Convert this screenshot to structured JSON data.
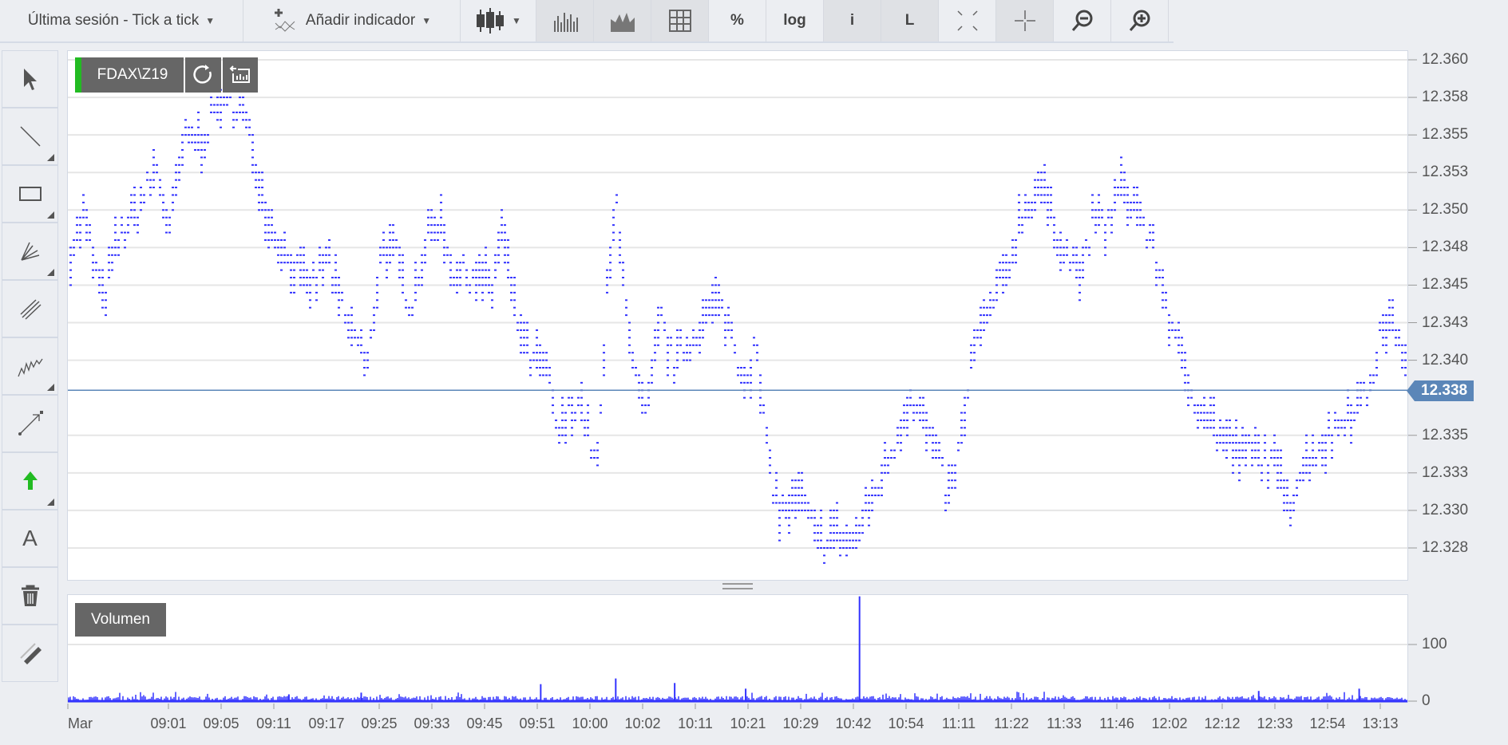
{
  "toolbar": {
    "period_label": "Última sesión - Tick a tick",
    "indicator_label": "Añadir indicador",
    "percent_label": "%",
    "log_label": "log",
    "info_label": "i",
    "L_label": "L"
  },
  "side_tools": [
    "cursor",
    "line",
    "rectangle",
    "fan",
    "parallel-lines",
    "freehand",
    "arrow-line",
    "green-arrow",
    "text",
    "trash",
    "eraser"
  ],
  "side_text_label": "A",
  "colors": {
    "ticks": "#3333ff",
    "current": "#5b86b8",
    "accent_green": "#22bb22"
  },
  "chart_data": {
    "type": "scatter",
    "symbol": "FDAX\\Z19",
    "volume_label": "Volumen",
    "current_price_label": "12.338",
    "current_price": 12338,
    "ylim": [
      12326,
      12361
    ],
    "y_ticks": [
      {
        "v": 12360,
        "label": "12.360"
      },
      {
        "v": 12357.5,
        "label": "12.358"
      },
      {
        "v": 12355,
        "label": "12.355"
      },
      {
        "v": 12352.5,
        "label": "12.353"
      },
      {
        "v": 12350,
        "label": "12.350"
      },
      {
        "v": 12347.5,
        "label": "12.348"
      },
      {
        "v": 12345,
        "label": "12.345"
      },
      {
        "v": 12342.5,
        "label": "12.343"
      },
      {
        "v": 12340,
        "label": "12.340"
      },
      {
        "v": 12335,
        "label": "12.335"
      },
      {
        "v": 12332.5,
        "label": "12.333"
      },
      {
        "v": 12330,
        "label": "12.330"
      },
      {
        "v": 12327.5,
        "label": "12.328"
      }
    ],
    "x_labels": [
      "Mar",
      "09:01",
      "09:05",
      "09:11",
      "09:17",
      "09:25",
      "09:33",
      "09:45",
      "09:51",
      "10:00",
      "10:02",
      "10:11",
      "10:21",
      "10:29",
      "10:42",
      "10:54",
      "11:11",
      "11:22",
      "11:33",
      "11:46",
      "12:02",
      "12:12",
      "12:33",
      "12:54",
      "13:13"
    ],
    "tick_range": [
      0,
      1000
    ],
    "price_path": [
      [
        0,
        12347
      ],
      [
        11,
        12350
      ],
      [
        25,
        12344
      ],
      [
        36,
        12348
      ],
      [
        50,
        12350
      ],
      [
        65,
        12353
      ],
      [
        75,
        12349
      ],
      [
        86,
        12355
      ],
      [
        100,
        12355
      ],
      [
        115,
        12358
      ],
      [
        129,
        12357
      ],
      [
        140,
        12353
      ],
      [
        151,
        12349
      ],
      [
        165,
        12347
      ],
      [
        179,
        12345
      ],
      [
        194,
        12347
      ],
      [
        205,
        12343
      ],
      [
        219,
        12341
      ],
      [
        222,
        12339
      ],
      [
        233,
        12348
      ],
      [
        244,
        12347
      ],
      [
        255,
        12344
      ],
      [
        266,
        12348
      ],
      [
        276,
        12350
      ],
      [
        287,
        12346
      ],
      [
        301,
        12346
      ],
      [
        316,
        12345
      ],
      [
        323,
        12349
      ],
      [
        334,
        12343
      ],
      [
        345,
        12340
      ],
      [
        355,
        12340
      ],
      [
        366,
        12335
      ],
      [
        380,
        12338
      ],
      [
        395,
        12333
      ],
      [
        402,
        12345
      ],
      [
        409,
        12351
      ],
      [
        420,
        12340
      ],
      [
        431,
        12336
      ],
      [
        441,
        12343
      ],
      [
        452,
        12340
      ],
      [
        467,
        12342
      ],
      [
        481,
        12344
      ],
      [
        492,
        12343
      ],
      [
        503,
        12339
      ],
      [
        513,
        12341
      ],
      [
        521,
        12334
      ],
      [
        531,
        12330
      ],
      [
        546,
        12331
      ],
      [
        559,
        12328
      ],
      [
        571,
        12329
      ],
      [
        585,
        12328
      ],
      [
        600,
        12331
      ],
      [
        614,
        12334
      ],
      [
        628,
        12338
      ],
      [
        643,
        12335
      ],
      [
        657,
        12331
      ],
      [
        668,
        12336
      ],
      [
        675,
        12341
      ],
      [
        689,
        12344
      ],
      [
        700,
        12346
      ],
      [
        711,
        12350
      ],
      [
        725,
        12352
      ],
      [
        736,
        12349
      ],
      [
        747,
        12347
      ],
      [
        757,
        12346
      ],
      [
        765,
        12350
      ],
      [
        775,
        12349
      ],
      [
        786,
        12352
      ],
      [
        800,
        12350
      ],
      [
        811,
        12347
      ],
      [
        822,
        12343
      ],
      [
        833,
        12339
      ],
      [
        847,
        12337
      ],
      [
        861,
        12335
      ],
      [
        876,
        12334
      ],
      [
        890,
        12334
      ],
      [
        901,
        12333
      ],
      [
        912,
        12331
      ],
      [
        926,
        12334
      ],
      [
        940,
        12335
      ],
      [
        955,
        12337
      ],
      [
        969,
        12338
      ],
      [
        983,
        12343
      ],
      [
        994,
        12342
      ],
      [
        1000,
        12338
      ]
    ],
    "volume": {
      "y_ticks": [
        {
          "v": 0,
          "label": "0"
        },
        {
          "v": 100,
          "label": "100"
        }
      ],
      "ylim": [
        0,
        185
      ],
      "spikes": [
        [
          165,
          12
        ],
        [
          219,
          15
        ],
        [
          353,
          30
        ],
        [
          409,
          40
        ],
        [
          453,
          32
        ],
        [
          506,
          22
        ],
        [
          591,
          185
        ],
        [
          889,
          18
        ],
        [
          964,
          22
        ]
      ],
      "typical_max": 8
    }
  }
}
